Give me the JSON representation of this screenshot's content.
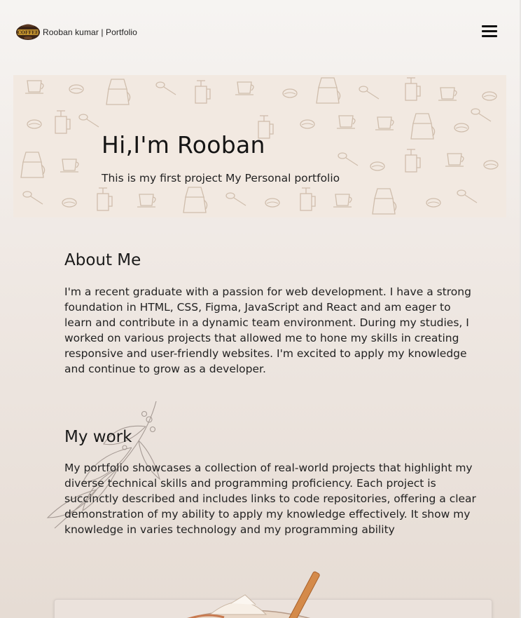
{
  "header": {
    "brand_text": "Rooban kumar | Portfolio",
    "logo_label": "COFFEE",
    "menu_icon": "hamburger-menu-icon"
  },
  "hero": {
    "title": "Hi,I'm Rooban",
    "subtitle": "This is my first project My Personal portfolio"
  },
  "about": {
    "title": "About Me",
    "body": "I'm a recent graduate with a passion for web development. I have a strong foundation in HTML, CSS, Figma, JavaScript and React and am eager to learn and contribute in a dynamic team environment. During my studies, I worked on various projects that allowed me to hone my skills in creating responsive and user-friendly websites. I'm excited to apply my knowledge and continue to grow as a developer."
  },
  "work": {
    "title": "My work",
    "body": "My portfolio showcases a collection of real-world projects that highlight my diverse technical skills and programming proficiency. Each project is succinctly described and includes links to code repositories, offering a clear demonstration of my ability to apply my knowledge effectively. It show my knowledge in varies technology and my programming ability"
  },
  "colors": {
    "background": "#efe8e3",
    "hero_background": "#f2e9e1",
    "pattern_stroke": "#c9b6a3",
    "text": "#1c1c1c"
  }
}
